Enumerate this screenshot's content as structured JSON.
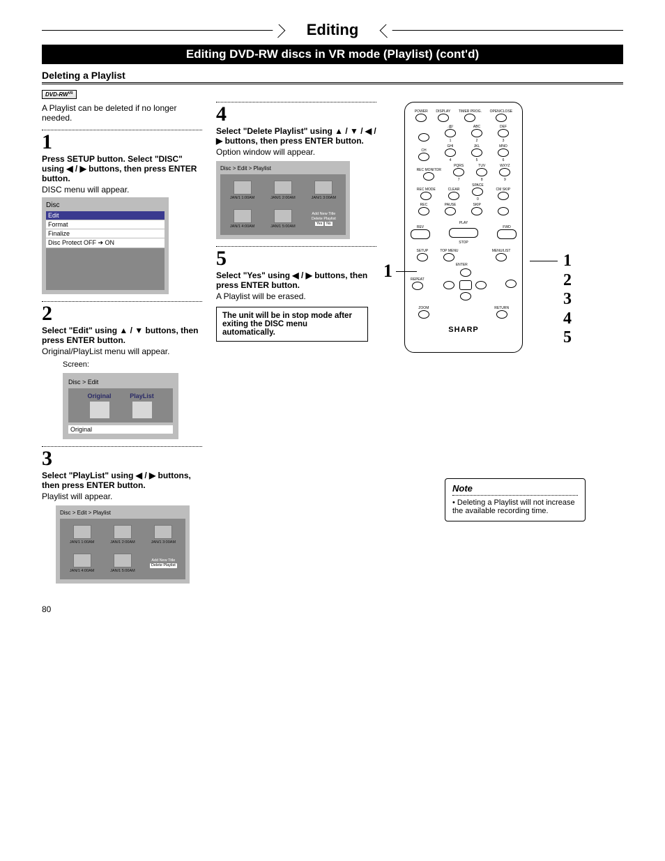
{
  "header": {
    "title": "Editing",
    "subtitle": "Editing DVD-RW discs in VR mode (Playlist) (cont'd)"
  },
  "section": {
    "head": "Deleting a Playlist",
    "badge": "DVD-RW",
    "badge_vr": "VR",
    "intro": "A Playlist can be deleted if no longer needed."
  },
  "step1": {
    "num": "1",
    "title": "Press SETUP button. Select \"DISC\" using ◀ / ▶ buttons, then press ENTER button.",
    "body": "DISC menu will appear.",
    "menu": {
      "header": "Disc",
      "items": [
        "Edit",
        "Format",
        "Finalize",
        "Disc Protect OFF ➔ ON"
      ],
      "selected_index": 0
    }
  },
  "step2": {
    "num": "2",
    "title": "Select \"Edit\" using ▲ / ▼ buttons, then press ENTER button.",
    "body": "Original/PlayList menu will appear.",
    "screen_label": "Screen:",
    "screen": {
      "header": "Disc > Edit",
      "options": [
        "Original",
        "PlayList"
      ],
      "footer": "Original"
    }
  },
  "step3": {
    "num": "3",
    "title": "Select \"PlayList\" using ◀ / ▶ buttons, then press ENTER button.",
    "body": "Playlist will appear.",
    "screen": {
      "header": "Disc > Edit > Playlist",
      "thumbs": [
        "JAN/1  1:00AM",
        "JAN/1  2:00AM",
        "JAN/1  3:00AM",
        "JAN/1  4:00AM",
        "JAN/1  5:00AM"
      ],
      "option_menu": [
        "Add New Title",
        "Delete Playlist"
      ]
    }
  },
  "step4": {
    "num": "4",
    "title": "Select \"Delete Playlist\" using ▲ / ▼ / ◀ / ▶ buttons, then press ENTER button.",
    "body": "Option window will appear.",
    "screen": {
      "header": "Disc > Edit > Playlist",
      "thumbs": [
        "JAN/1  1:00AM",
        "JAN/1  2:00AM",
        "JAN/1  3:00AM",
        "JAN/1  4:00AM",
        "JAN/1  5:00AM"
      ],
      "option_menu": [
        "Add New Title",
        "Delete Playlist"
      ],
      "confirm": [
        "Yes",
        "No"
      ]
    }
  },
  "step5": {
    "num": "5",
    "title": "Select \"Yes\" using ◀ / ▶ buttons, then press ENTER button.",
    "body": "A Playlist will be erased.",
    "info": "The unit will be in stop mode after exiting the DISC menu automatically."
  },
  "remote": {
    "labels_row1": [
      "POWER",
      "",
      "TIMER PROG.",
      "OPEN/CLOSE"
    ],
    "labels_row2": [
      "",
      "DISPLAY",
      "",
      ""
    ],
    "labels_row3": [
      "",
      ".@/",
      "ABC",
      "DEF"
    ],
    "nums_row3": [
      "",
      "1",
      "2",
      "3"
    ],
    "labels_row4": [
      "CH",
      "GHI",
      "JKL",
      "MNO"
    ],
    "nums_row4": [
      "",
      "4",
      "5",
      "6"
    ],
    "labels_row5": [
      "REC MONITOR",
      "PQRS",
      "TUV",
      "WXYZ"
    ],
    "nums_row5": [
      "",
      "7",
      "8",
      "9"
    ],
    "labels_row6": [
      "REC MODE",
      "CLEAR",
      "SPACE",
      "CM SKIP"
    ],
    "nums_row6": [
      "",
      "",
      "0",
      ""
    ],
    "labels_row7": [
      "REC",
      "PAUSE",
      "SKIP",
      ""
    ],
    "play": "PLAY",
    "rev": "REV",
    "fwd": "FWD",
    "stop": "STOP",
    "setup": "SETUP",
    "topmenu": "TOP MENU",
    "menulist": "MENU/LIST",
    "repeat": "REPEAT",
    "enter": "ENTER",
    "zoom": "ZOOM",
    "return": "RETURN",
    "brand": "SHARP",
    "callout_left": "1",
    "callout_right": [
      "1",
      "2",
      "3",
      "4",
      "5"
    ]
  },
  "note": {
    "head": "Note",
    "body": "• Deleting a Playlist will not increase the available recording time."
  },
  "page_number": "80"
}
